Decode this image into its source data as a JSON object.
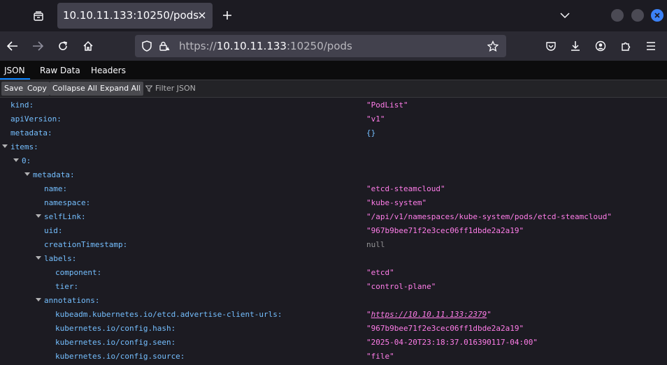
{
  "tab": {
    "title": "10.10.11.133:10250/pods"
  },
  "urlbar": {
    "scheme": "https://",
    "host": "10.10.11.133",
    "rest": ":10250/pods"
  },
  "viewer_tabs": [
    "JSON",
    "Raw Data",
    "Headers"
  ],
  "toolbar": {
    "save": "Save",
    "copy": "Copy",
    "collapse_all": "Collapse All",
    "expand_all": "Expand All",
    "filter_placeholder": "Filter JSON"
  },
  "rows": [
    {
      "key": "kind:",
      "value": "\"PodList\"",
      "type": "str",
      "depth": 0,
      "expander": false
    },
    {
      "key": "apiVersion:",
      "value": "\"v1\"",
      "type": "str",
      "depth": 0,
      "expander": false
    },
    {
      "key": "metadata:",
      "value": "{}",
      "type": "obj",
      "depth": 0,
      "expander": false
    },
    {
      "key": "items:",
      "value": "",
      "type": "none",
      "depth": 0,
      "expander": true
    },
    {
      "key": "0:",
      "value": "",
      "type": "none",
      "depth": 1,
      "expander": true
    },
    {
      "key": "metadata:",
      "value": "",
      "type": "none",
      "depth": 2,
      "expander": true
    },
    {
      "key": "name:",
      "value": "\"etcd-steamcloud\"",
      "type": "str",
      "depth": 3,
      "expander": false
    },
    {
      "key": "namespace:",
      "value": "\"kube-system\"",
      "type": "str",
      "depth": 3,
      "expander": false
    },
    {
      "key": "selfLink:",
      "value": "\"/api/v1/namespaces/kube-system/pods/etcd-steamcloud\"",
      "type": "str",
      "depth": 3,
      "expander": true
    },
    {
      "key": "uid:",
      "value": "\"967b9bee71f2e3cec06ff1dbde2a2a19\"",
      "type": "str",
      "depth": 3,
      "expander": false
    },
    {
      "key": "creationTimestamp:",
      "value": "null",
      "type": "null",
      "depth": 3,
      "expander": false
    },
    {
      "key": "labels:",
      "value": "",
      "type": "none",
      "depth": 3,
      "expander": true
    },
    {
      "key": "component:",
      "value": "\"etcd\"",
      "type": "str",
      "depth": 4,
      "expander": false
    },
    {
      "key": "tier:",
      "value": "\"control-plane\"",
      "type": "str",
      "depth": 4,
      "expander": false
    },
    {
      "key": "annotations:",
      "value": "",
      "type": "none",
      "depth": 3,
      "expander": true
    },
    {
      "key": "kubeadm.kubernetes.io/etcd.advertise-client-urls:",
      "value": "https://10.10.11.133:2379",
      "type": "link",
      "depth": 4,
      "expander": false
    },
    {
      "key": "kubernetes.io/config.hash:",
      "value": "\"967b9bee71f2e3cec06ff1dbde2a2a19\"",
      "type": "str",
      "depth": 4,
      "expander": false
    },
    {
      "key": "kubernetes.io/config.seen:",
      "value": "\"2025-04-20T23:18:37.016390117-04:00\"",
      "type": "str",
      "depth": 4,
      "expander": false
    },
    {
      "key": "kubernetes.io/config.source:",
      "value": "\"file\"",
      "type": "str",
      "depth": 4,
      "expander": false
    }
  ]
}
